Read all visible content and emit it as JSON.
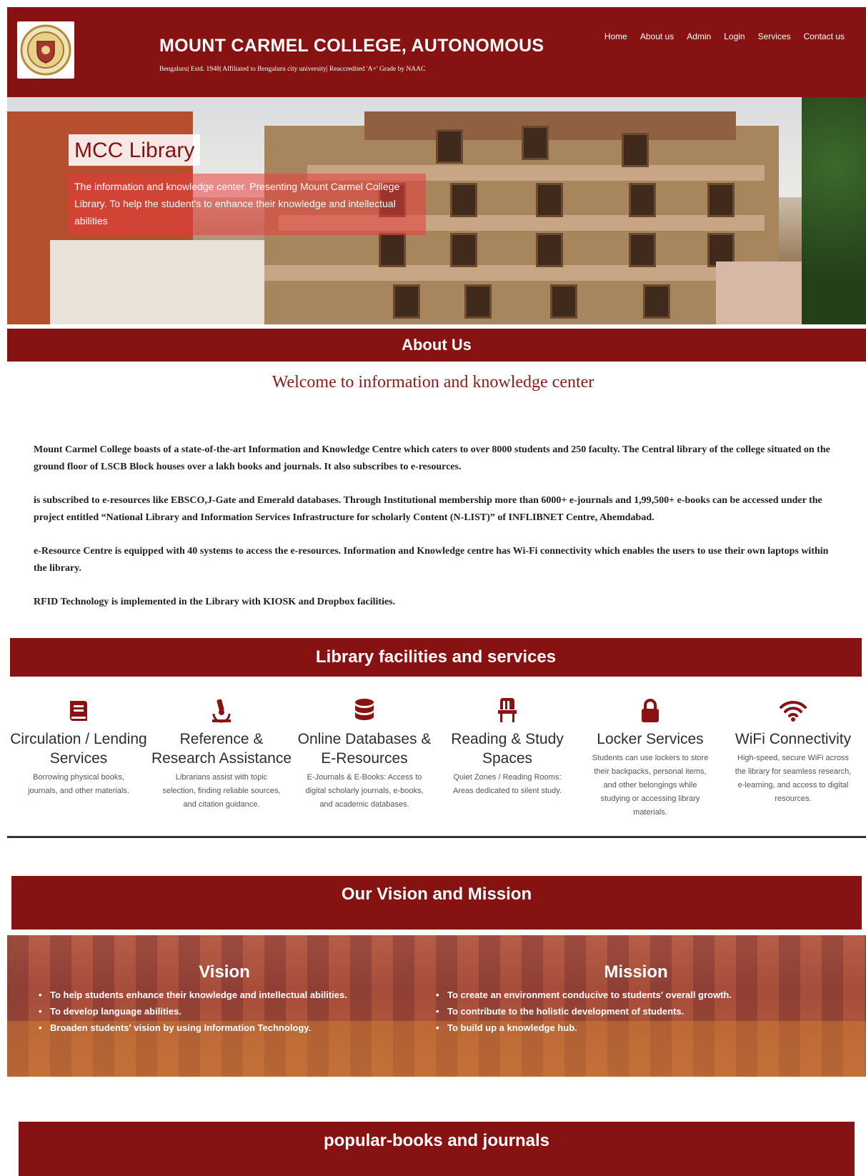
{
  "header": {
    "college_name": "MOUNT CARMEL COLLEGE, AUTONOMOUS",
    "subtitle": "Bengaluru| Estd. 1948| Affiliated to Bengaluru city university| Reaccredited 'A+' Grade by NAAC",
    "logo_icon": "college-crest-icon",
    "nav": [
      "Home",
      "About us",
      "Admin",
      "Login",
      "Services",
      "Contact us"
    ]
  },
  "hero": {
    "title": "MCC Library",
    "description": "The information and knowledge center. Presenting Mount Carmel College Library. To help the student's to enhance their knowledge and intellectual abilities"
  },
  "about": {
    "heading": "About Us",
    "welcome": "Welcome to information and knowledge center",
    "paragraphs": [
      "Mount Carmel College boasts of a state-of-the-art Information and Knowledge Centre which caters to over 8000 students and 250 faculty. The Central library of the college situated on the ground floor of LSCB Block houses over a lakh books and journals. It also subscribes to e-resources.",
      "is subscribed to e-resources like EBSCO,J-Gate and Emerald databases. Through Institutional membership more than 6000+ e-journals and 1,99,500+ e-books can be accessed under the project entitled “National Library and Information Services Infrastructure for scholarly Content (N-LIST)” of INFLIBNET Centre, Ahemdabad.",
      "e-Resource Centre is equipped with 40 systems to access the e-resources. Information and Knowledge centre has Wi-Fi connectivity which enables the users to use their own laptops within the library.",
      "RFID Technology is implemented in the Library with KIOSK and Dropbox facilities."
    ]
  },
  "facilities": {
    "heading": "Library facilities and services",
    "items": [
      {
        "icon": "book-icon",
        "title": "Circulation / Lending Services",
        "desc": "Borrowing physical books, journals, and other materials."
      },
      {
        "icon": "microscope-icon",
        "title": "Reference & Research Assistance",
        "desc": "Librarians assist with topic selection, finding reliable sources, and citation guidance."
      },
      {
        "icon": "database-icon",
        "title": "Online Databases & E-Resources",
        "desc": "E-Journals & E-Books: Access to digital scholarly journals, e-books, and academic databases."
      },
      {
        "icon": "chair-icon",
        "title": "Reading & Study Spaces",
        "desc": "Quiet Zones / Reading Rooms: Areas dedicated to silent study."
      },
      {
        "icon": "lock-icon",
        "title": "Locker Services",
        "desc": "Students can use lockers to store their backpacks, personal items, and other belongings while studying or accessing library materials."
      },
      {
        "icon": "wifi-icon",
        "title": "WiFi Connectivity",
        "desc": "High-speed, secure WiFi across the library for seamless research, e-learning, and access to digital resources."
      }
    ],
    "accent": "#8b1212"
  },
  "vision_mission": {
    "heading": "Our Vision and Mission",
    "vision_title": "Vision",
    "vision": [
      "To help students enhance their knowledge and intellectual abilities.",
      "To develop language abilities.",
      "Broaden students' vision by using Information Technology."
    ],
    "mission_title": "Mission",
    "mission": [
      "To create an environment conducive to students' overall growth.",
      "To contribute to the holistic development of students.",
      "To build up a knowledge hub."
    ]
  },
  "books": {
    "heading": "popular-books and journals"
  },
  "colors": {
    "brand": "#861212",
    "hero_overlay": "#e83c3c"
  }
}
